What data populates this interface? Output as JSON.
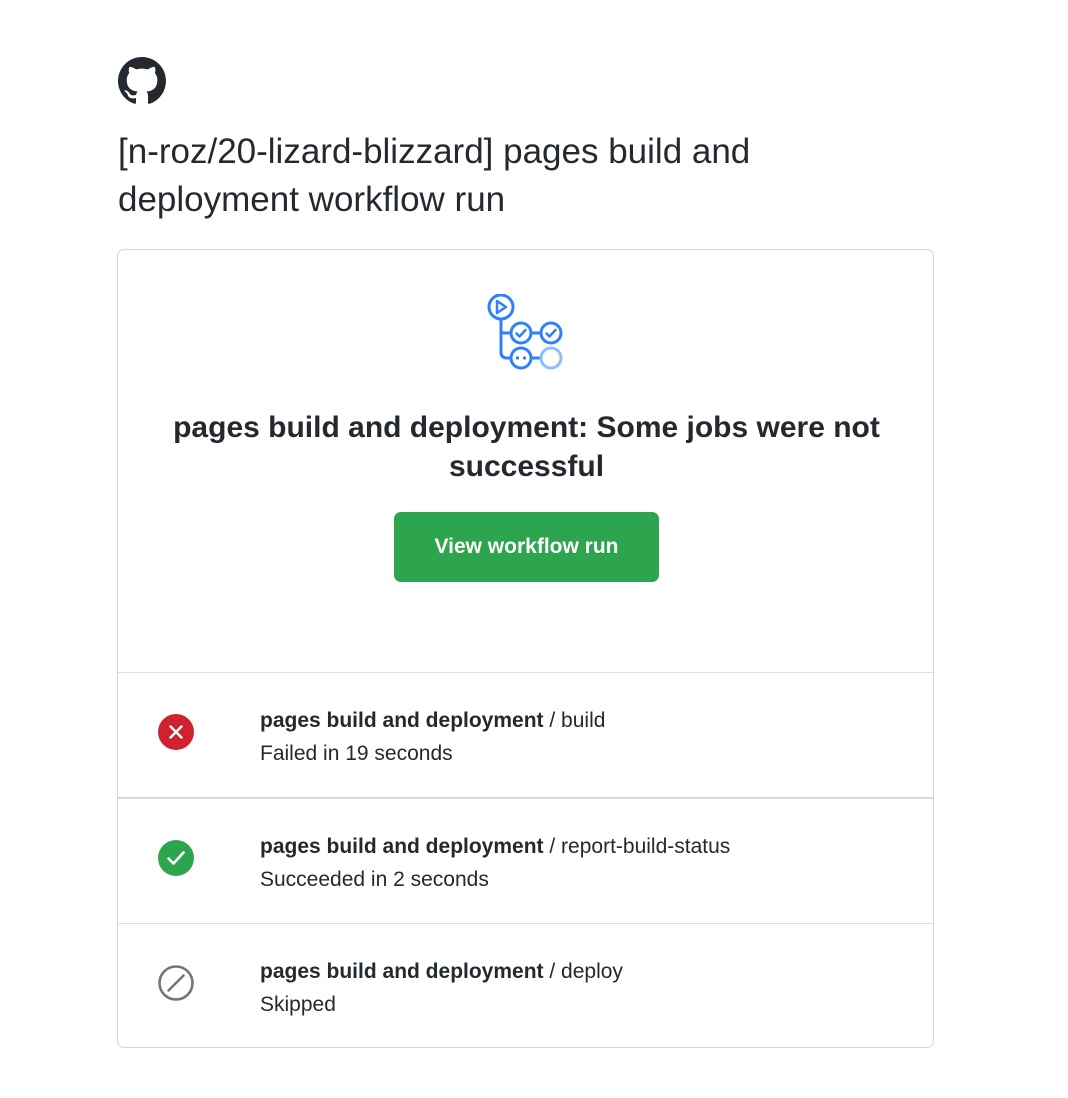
{
  "brand": {
    "logo_icon": "github-mark-icon"
  },
  "page": {
    "title": "[n-roz/20-lizard-blizzard] pages build and deployment workflow run"
  },
  "summary": {
    "graphic_icon": "workflow-graph-icon",
    "heading": "pages build and deployment: Some jobs were not successful",
    "button_label": "View workflow run",
    "button_color": "#2da44e"
  },
  "jobs": [
    {
      "workflow": "pages build and deployment",
      "separator": " / ",
      "job": "build",
      "status": "Failed in 19 seconds",
      "icon": "failed-x-circle-icon",
      "color": "#cf222e"
    },
    {
      "workflow": "pages build and deployment",
      "separator": " / ",
      "job": "report-build-status",
      "status": "Succeeded in 2 seconds",
      "icon": "success-check-circle-icon",
      "color": "#2da44e"
    },
    {
      "workflow": "pages build and deployment",
      "separator": " / ",
      "job": "deploy",
      "status": "Skipped",
      "icon": "skipped-slash-circle-icon",
      "color": "#6e7781"
    }
  ]
}
